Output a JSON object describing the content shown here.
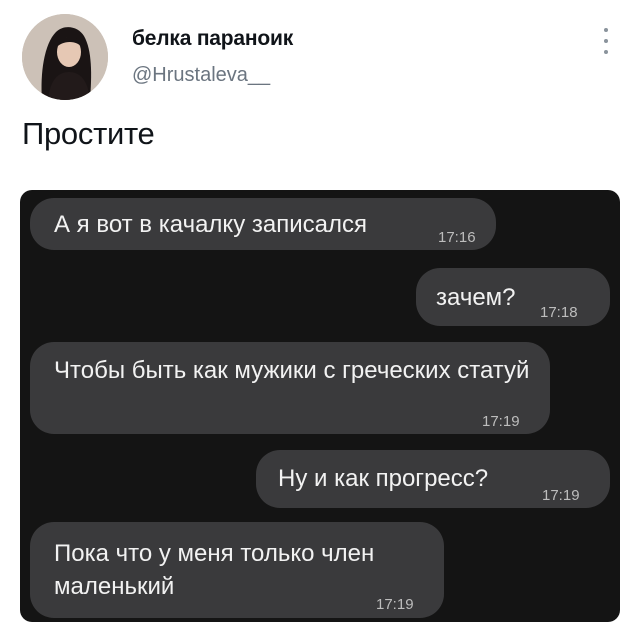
{
  "tweet": {
    "author": {
      "display_name": "белка параноик",
      "handle": "@Hrustaleva__"
    },
    "text": "Простите",
    "menu_icon": "more-vertical-icon"
  },
  "chat": {
    "messages": [
      {
        "side": "incoming",
        "text": "А я вот в качалку записался",
        "time": "17:16"
      },
      {
        "side": "outgoing",
        "text": "зачем?",
        "time": "17:18"
      },
      {
        "side": "incoming",
        "text": "Чтобы быть как мужики с греческих статуй",
        "time": "17:19"
      },
      {
        "side": "outgoing",
        "text": "Ну и как прогресс?",
        "time": "17:19"
      },
      {
        "side": "incoming",
        "text": "Пока что у меня только член маленький",
        "time": "17:19"
      }
    ],
    "colors": {
      "background": "#141414",
      "bubble": "#3a3a3c",
      "text": "#f2f2f2",
      "time": "#bdbdbd"
    }
  }
}
